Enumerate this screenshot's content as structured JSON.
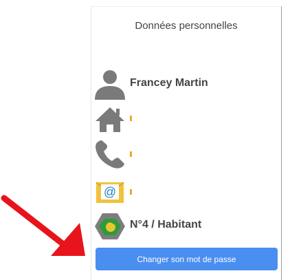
{
  "panel": {
    "title": "Données personnelles",
    "name": "Francey Martin",
    "home_value": "",
    "phone_value": "",
    "email_value": "",
    "housing": "N°4 / Habitant",
    "button_label": "Changer son mot de passe"
  },
  "icons": {
    "user": "user-icon",
    "home": "home-icon",
    "phone": "phone-icon",
    "email": "email-icon",
    "housing": "housing-logo-icon",
    "arrow": "red-arrow-annotation"
  },
  "colors": {
    "icon_gray": "#7a7a7a",
    "button_blue": "#4a8ef0",
    "arrow_red": "#e8141b",
    "email_yellow": "#f0c33a",
    "accent_orange": "#f5a623"
  }
}
